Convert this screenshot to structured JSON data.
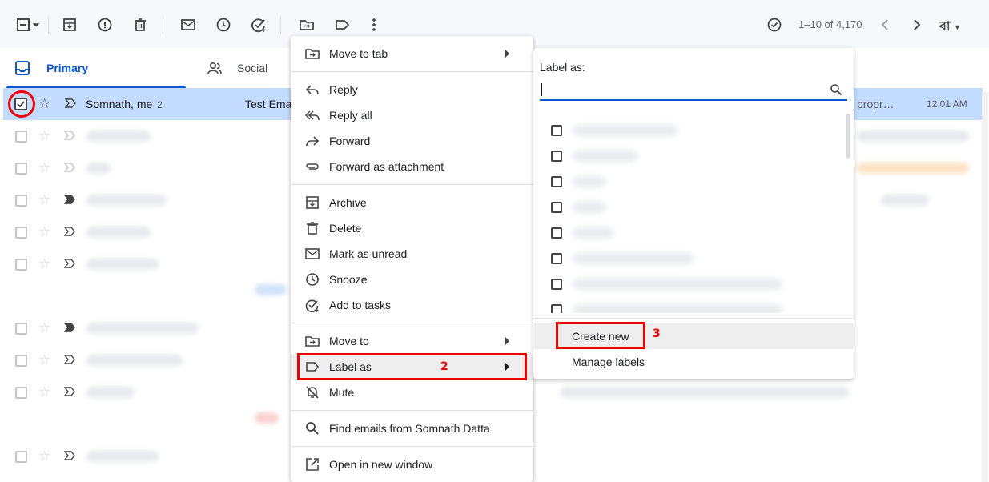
{
  "toolbar": {
    "pager": "1–10 of 4,170",
    "input_tool": "বা",
    "icons": [
      "select-checkbox-icon",
      "select-dropdown-icon",
      "archive-icon",
      "report-spam-icon",
      "delete-icon",
      "mark-unread-icon",
      "snooze-icon",
      "add-to-tasks-icon",
      "move-to-icon",
      "label-icon",
      "more-options-icon",
      "older-newer-icon",
      "newer-icon",
      "older-icon",
      "input-tools-icon"
    ]
  },
  "tabs": {
    "primary": "Primary",
    "social": "Social"
  },
  "selected_email": {
    "sender": "Somnath, me",
    "count": "2",
    "subject": "Test Ema",
    "snippet": "propr…",
    "time": "12:01 AM"
  },
  "context_menu": {
    "items": [
      {
        "label": "Move to tab",
        "icon": "move-to-tab-icon"
      },
      {
        "label": "Reply",
        "icon": "reply-icon"
      },
      {
        "label": "Reply all",
        "icon": "reply-all-icon"
      },
      {
        "label": "Forward",
        "icon": "forward-icon"
      },
      {
        "label": "Forward as attachment",
        "icon": "attachment-icon"
      },
      {
        "label": "Archive",
        "icon": "archive-icon"
      },
      {
        "label": "Delete",
        "icon": "delete-icon"
      },
      {
        "label": "Mark as unread",
        "icon": "mail-icon"
      },
      {
        "label": "Snooze",
        "icon": "clock-icon"
      },
      {
        "label": "Add to tasks",
        "icon": "task-icon"
      },
      {
        "label": "Move to",
        "icon": "move-to-icon"
      },
      {
        "label": "Label as",
        "icon": "label-icon"
      },
      {
        "label": "Mute",
        "icon": "mute-icon"
      },
      {
        "label": "Find emails from Somnath Datta",
        "icon": "search-icon"
      },
      {
        "label": "Open in new window",
        "icon": "open-new-window-icon"
      }
    ]
  },
  "label_submenu": {
    "title": "Label as:",
    "create_new": "Create new",
    "manage_labels": "Manage labels"
  },
  "annotations": {
    "step2": "2",
    "step3": "3",
    "color": "#ee0000"
  }
}
